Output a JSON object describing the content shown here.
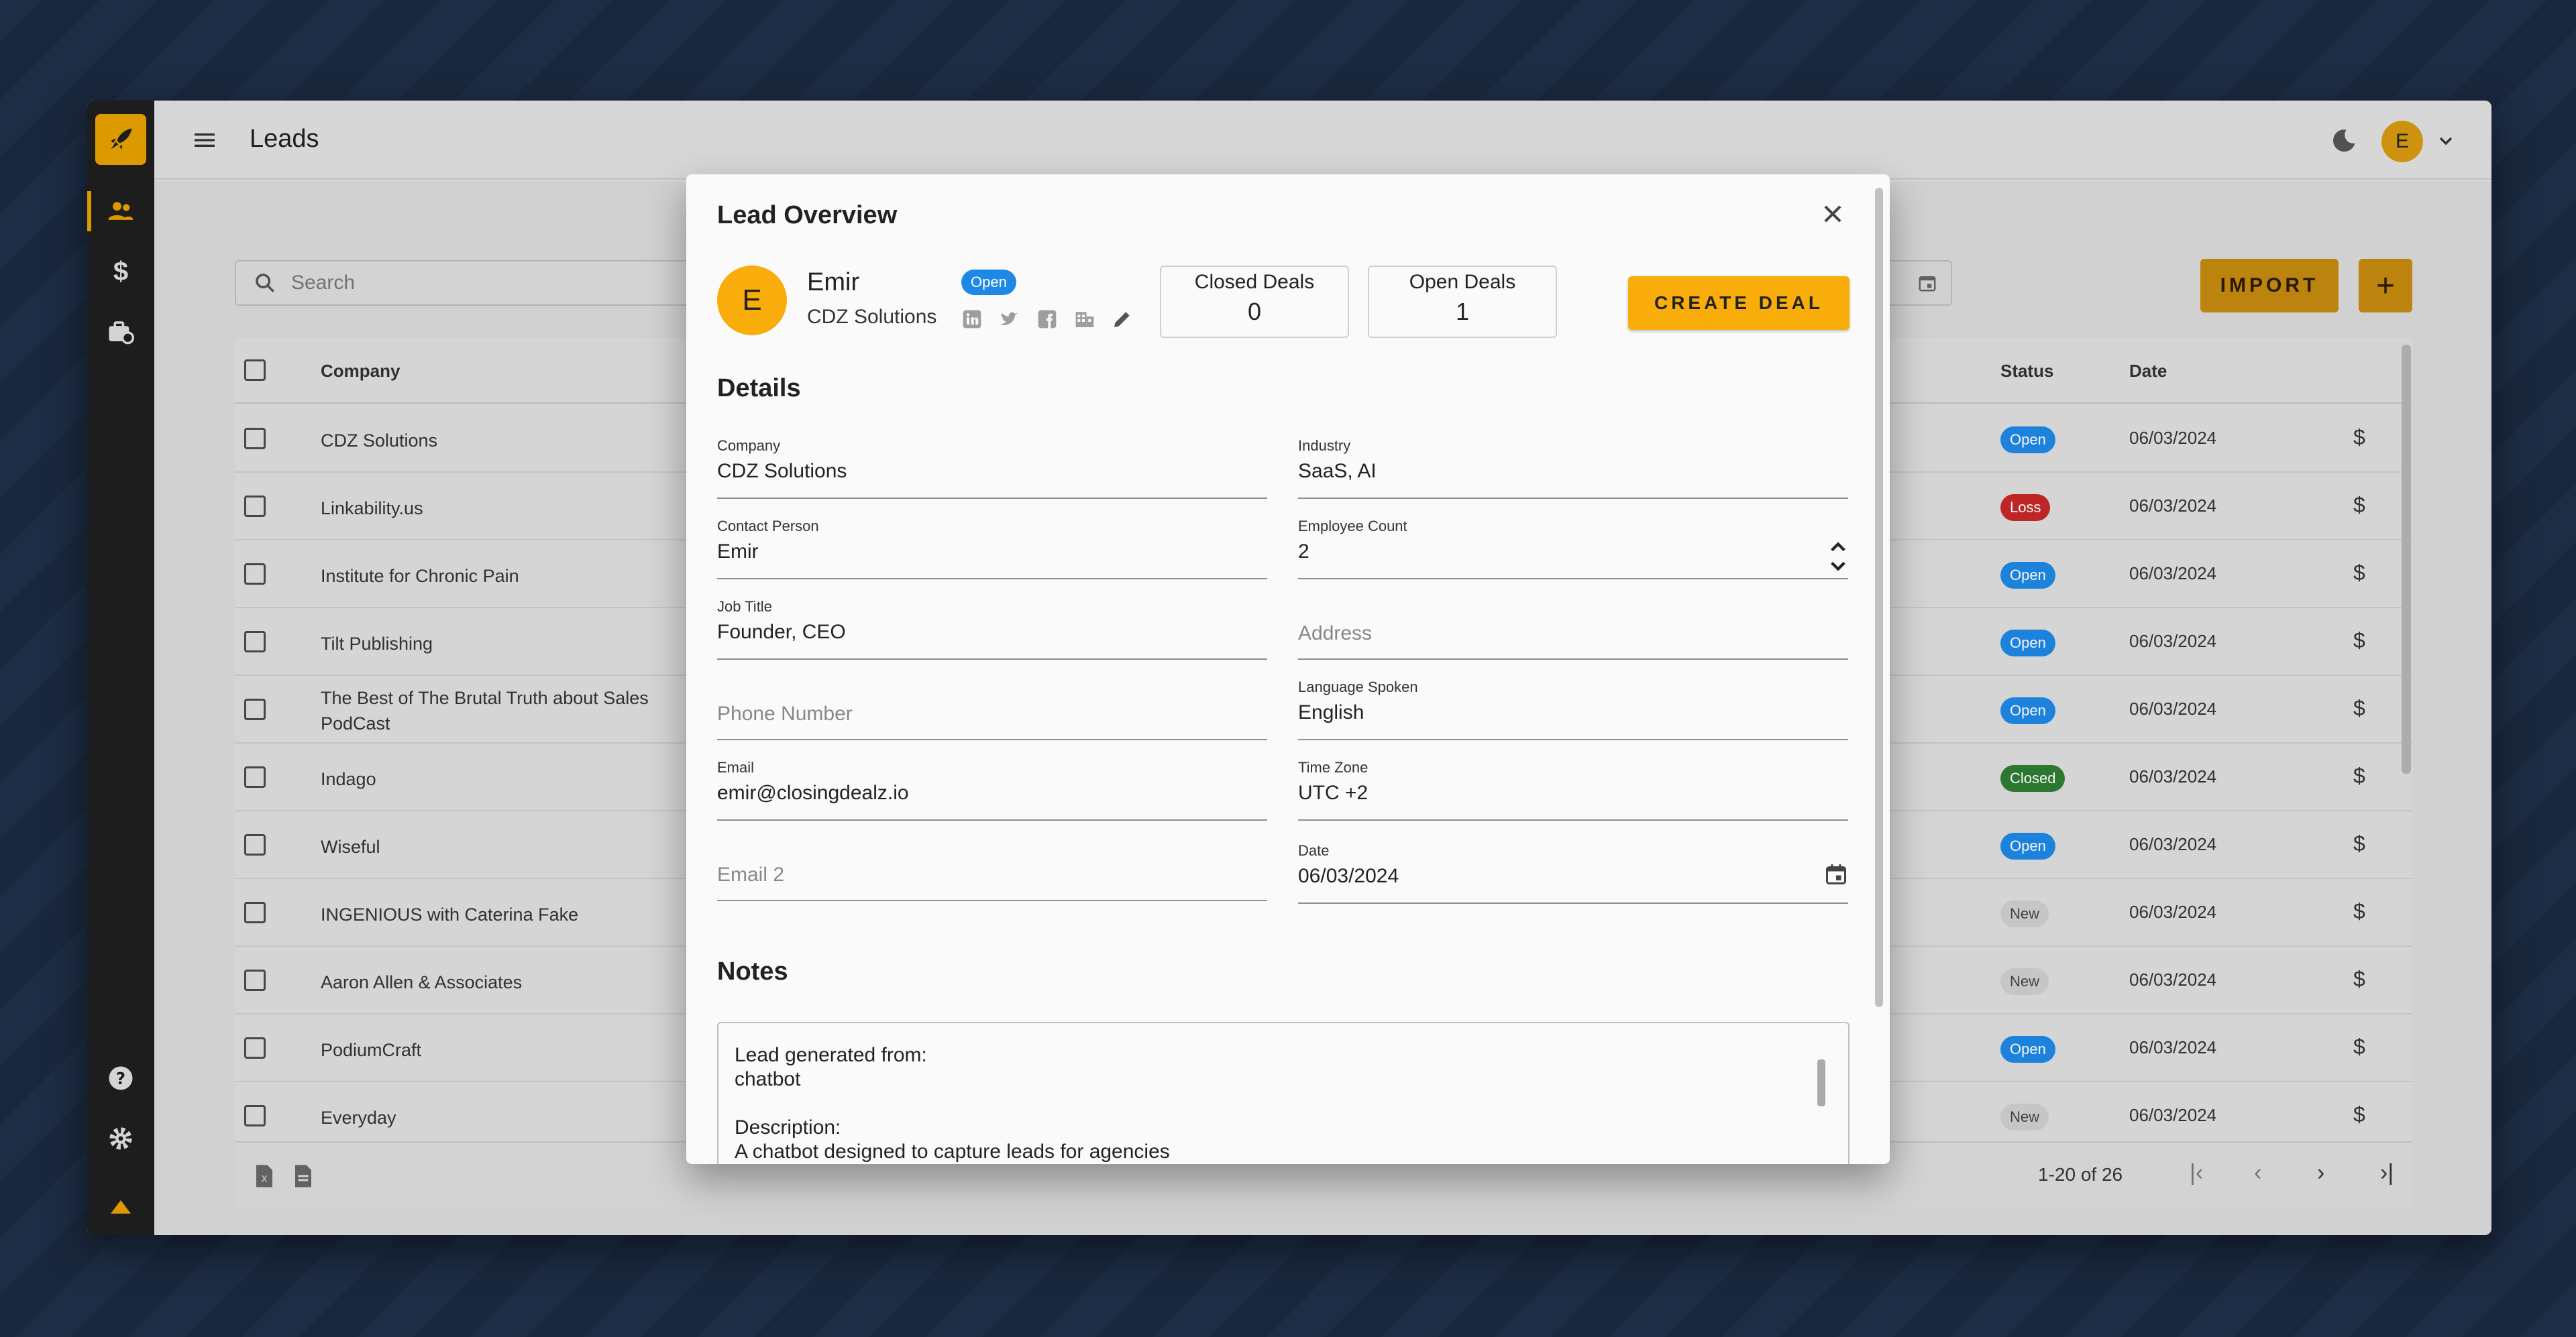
{
  "app": {
    "page_title": "Leads",
    "avatar_initial": "E"
  },
  "toolbar": {
    "search_placeholder": "Search",
    "import_label": "IMPORT",
    "add_label": "+"
  },
  "table": {
    "headers": {
      "company": "Company",
      "status": "Status",
      "date": "Date"
    },
    "rows": [
      {
        "company": "CDZ Solutions",
        "status": "Open",
        "date": "06/03/2024"
      },
      {
        "company": "Linkability.us",
        "status": "Loss",
        "date": "06/03/2024"
      },
      {
        "company": "Institute for Chronic Pain",
        "status": "Open",
        "date": "06/03/2024"
      },
      {
        "company": "Tilt Publishing",
        "status": "Open",
        "date": "06/03/2024"
      },
      {
        "company": "The Best of The Brutal Truth about Sales PodCast",
        "status": "Open",
        "date": "06/03/2024"
      },
      {
        "company": "Indago",
        "status": "Closed",
        "date": "06/03/2024"
      },
      {
        "company": "Wiseful",
        "status": "Open",
        "date": "06/03/2024"
      },
      {
        "company": "INGENIOUS with Caterina Fake",
        "status": "New",
        "date": "06/03/2024"
      },
      {
        "company": "Aaron Allen & Associates",
        "status": "New",
        "date": "06/03/2024"
      },
      {
        "company": "PodiumCraft",
        "status": "Open",
        "date": "06/03/2024"
      },
      {
        "company": "Everyday",
        "status": "New",
        "date": "06/03/2024"
      }
    ],
    "pagination": "1-20 of 26",
    "dollar": "$"
  },
  "status_colors": {
    "Open": "#1e88e5",
    "Loss": "#c62828",
    "Closed": "#2e7d32",
    "New": "#cfcfcf"
  },
  "modal": {
    "title": "Lead Overview",
    "lead": {
      "initial": "E",
      "name": "Emir",
      "company": "CDZ Solutions",
      "status": "Open"
    },
    "stats": {
      "closed_label": "Closed Deals",
      "closed_value": "0",
      "open_label": "Open Deals",
      "open_value": "1"
    },
    "create_deal_label": "CREATE DEAL",
    "details_title": "Details",
    "fields": {
      "company": {
        "label": "Company",
        "value": "CDZ Solutions"
      },
      "industry": {
        "label": "Industry",
        "value": "SaaS, AI"
      },
      "contact": {
        "label": "Contact Person",
        "value": "Emir"
      },
      "employee_count": {
        "label": "Employee Count",
        "value": "2"
      },
      "job_title": {
        "label": "Job Title",
        "value": "Founder, CEO"
      },
      "address": {
        "placeholder": "Address"
      },
      "phone": {
        "placeholder": "Phone Number"
      },
      "language": {
        "label": "Language Spoken",
        "value": "English"
      },
      "email": {
        "label": "Email",
        "value": "emir@closingdealz.io"
      },
      "timezone": {
        "label": "Time Zone",
        "value": "UTC +2"
      },
      "email2": {
        "placeholder": "Email 2"
      },
      "date": {
        "label": "Date",
        "value": "06/03/2024"
      }
    },
    "notes_title": "Notes",
    "notes": {
      "line1": "Lead generated from:",
      "line2": "chatbot",
      "line3": "Description:",
      "line4": "A chatbot designed to capture leads for agencies"
    }
  },
  "colors": {
    "accent": "#f8ad0a",
    "rail": "#1f1f1f"
  }
}
